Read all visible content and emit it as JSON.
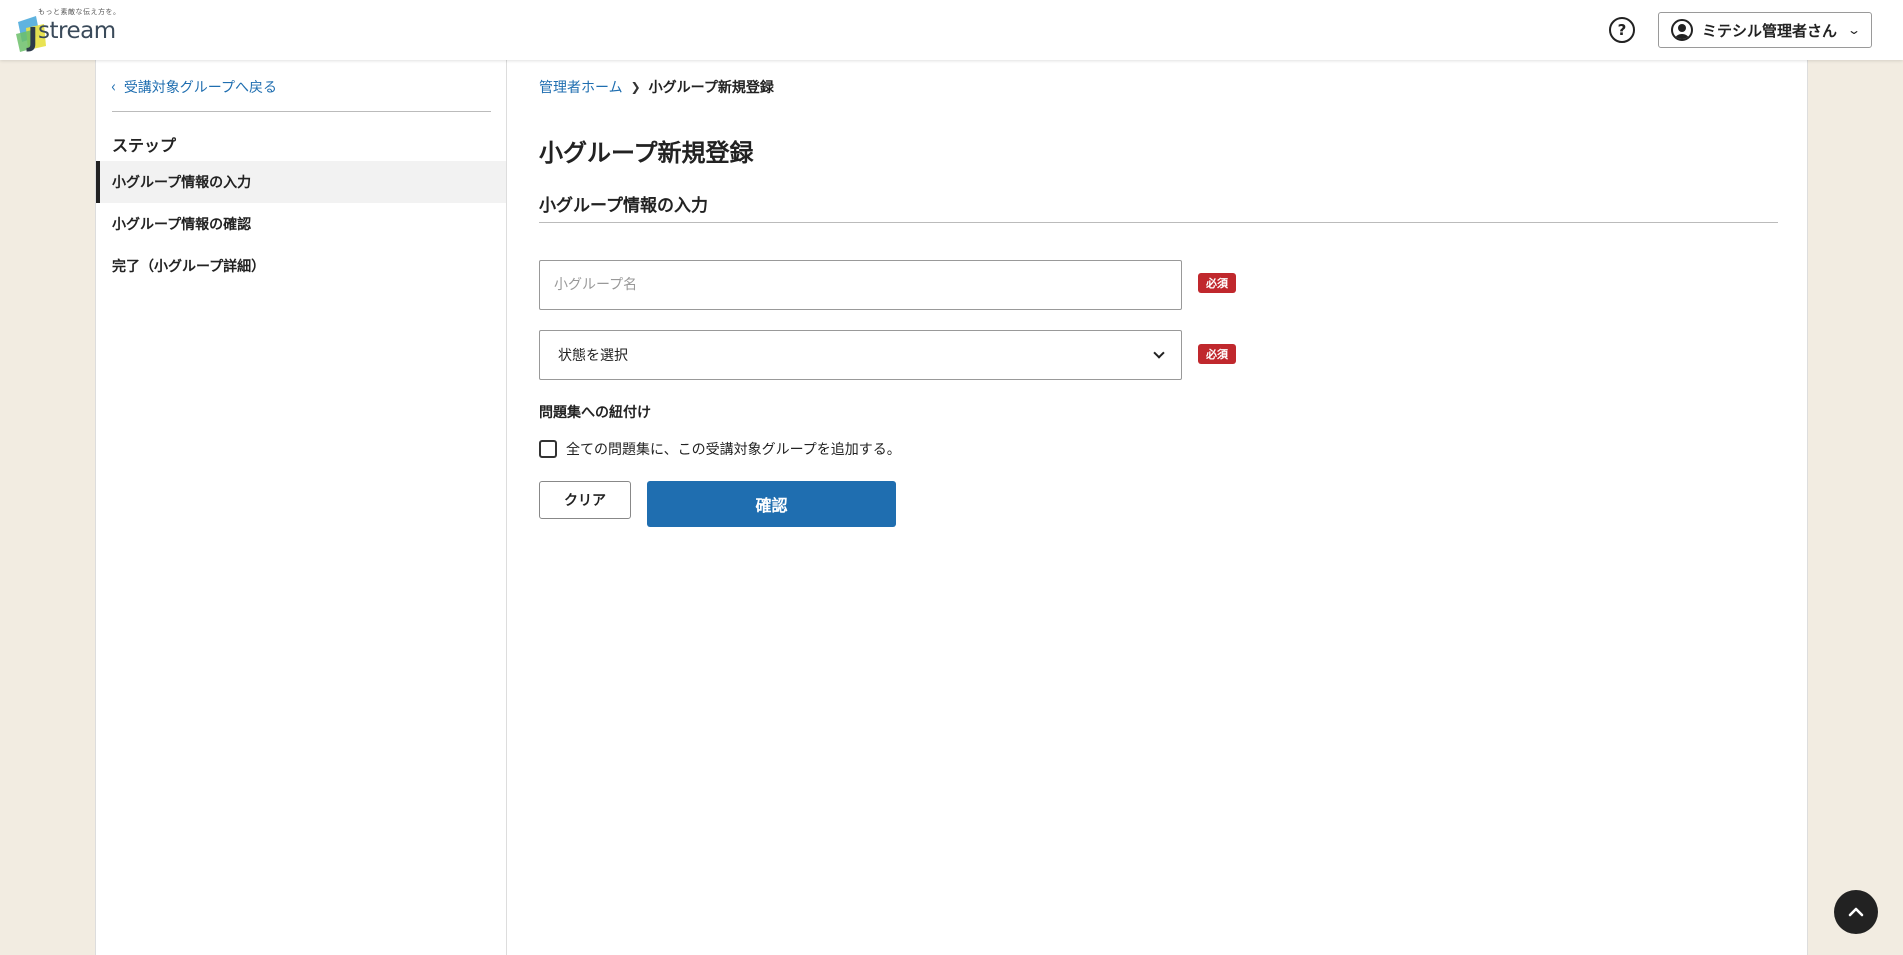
{
  "header": {
    "logo": {
      "tagline": "もっと素敵な伝え方を。",
      "text": "stream"
    },
    "help_icon": "question-circle-icon",
    "user_menu": {
      "name": "ミテシル管理者さん",
      "avatar_icon": "user-circle-icon",
      "chevron": "chevron-down-icon"
    }
  },
  "sidebar": {
    "back_link": "受講対象グループへ戻る",
    "steps_heading": "ステップ",
    "steps": [
      {
        "label": "小グループ情報の入力",
        "active": true
      },
      {
        "label": "小グループ情報の確認",
        "active": false
      },
      {
        "label": "完了（小グループ詳細）",
        "active": false
      }
    ]
  },
  "main": {
    "breadcrumb": {
      "home": "管理者ホーム",
      "current": "小グループ新規登録"
    },
    "page_title": "小グループ新規登録",
    "section_heading": "小グループ情報の入力",
    "name_input": {
      "placeholder": "小グループ名",
      "value": ""
    },
    "status_select": {
      "value": "状態を選択"
    },
    "required_badge": "必須",
    "link_label": "問題集への紐付け",
    "checkbox_label": "全ての問題集に、この受講対象グループを追加する。",
    "checkbox_checked": false,
    "clear_button": "クリア",
    "confirm_button": "確認"
  },
  "colors": {
    "accent": "#1f6eb0",
    "required": "#c0282d",
    "background": "#f2ece1"
  }
}
